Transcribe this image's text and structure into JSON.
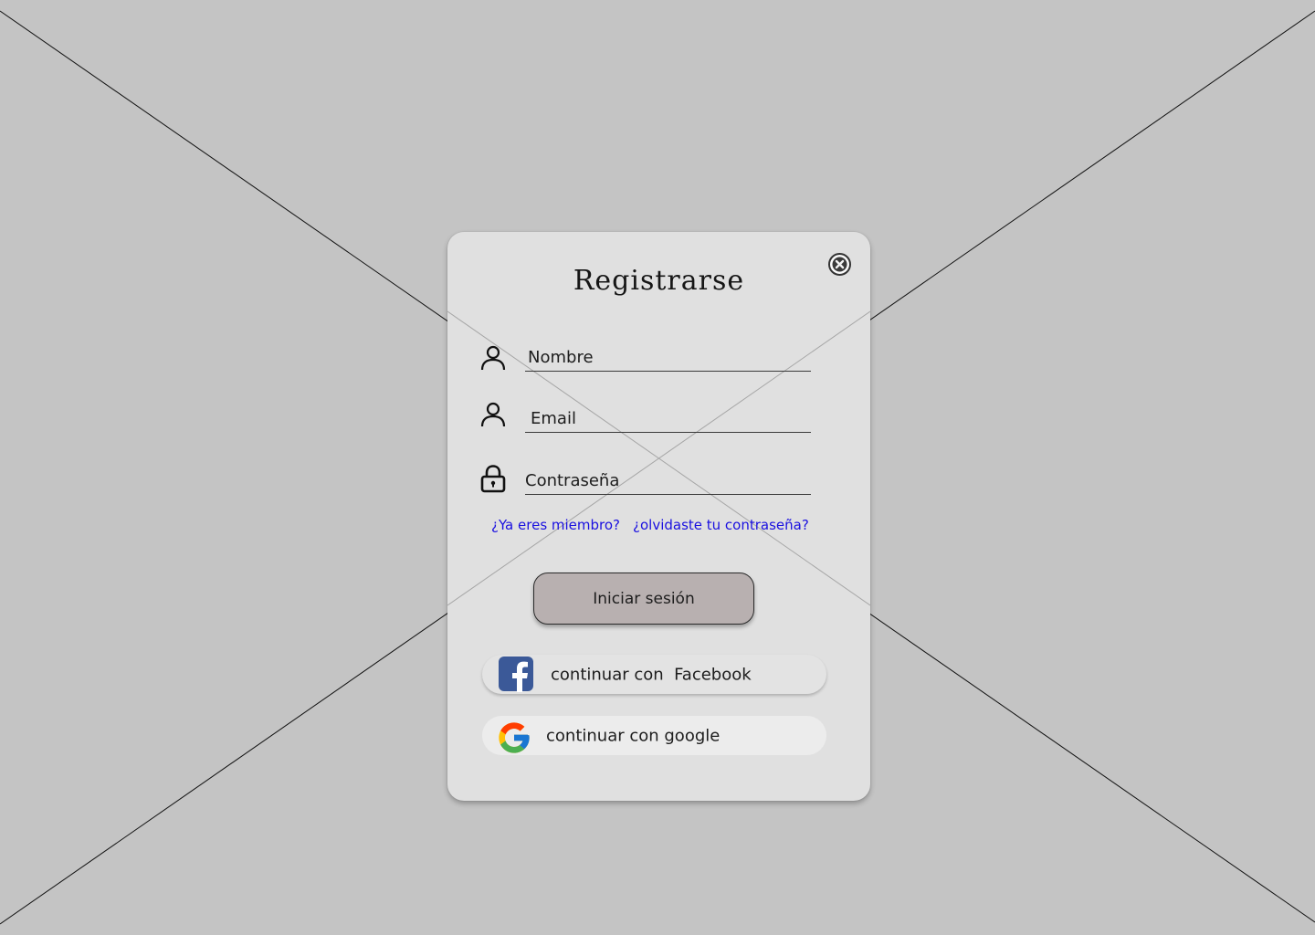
{
  "background": {
    "placeholder": "image-placeholder-cross",
    "color": "#c4c4c4"
  },
  "modal": {
    "title": "Registrarse",
    "close_icon": "close-circle-icon",
    "background": "#e0e0e0"
  },
  "form": {
    "fields": [
      {
        "label": "Nombre",
        "icon": "user-icon"
      },
      {
        "label": "Email",
        "icon": "user-icon"
      },
      {
        "label": "Contraseña",
        "icon": "lock-icon"
      }
    ]
  },
  "links": {
    "member": "¿Ya eres miembro?",
    "forgot": "¿olvidaste tu contraseña?",
    "color": "#1a10e0"
  },
  "primary_button": {
    "label": "Iniciar sesión",
    "background": "#b8b0b0"
  },
  "social": {
    "facebook": {
      "label": "continuar con  Facebook",
      "icon": "facebook-icon",
      "color": "#3b5998"
    },
    "google": {
      "label": "continuar con google",
      "icon": "google-icon"
    }
  }
}
